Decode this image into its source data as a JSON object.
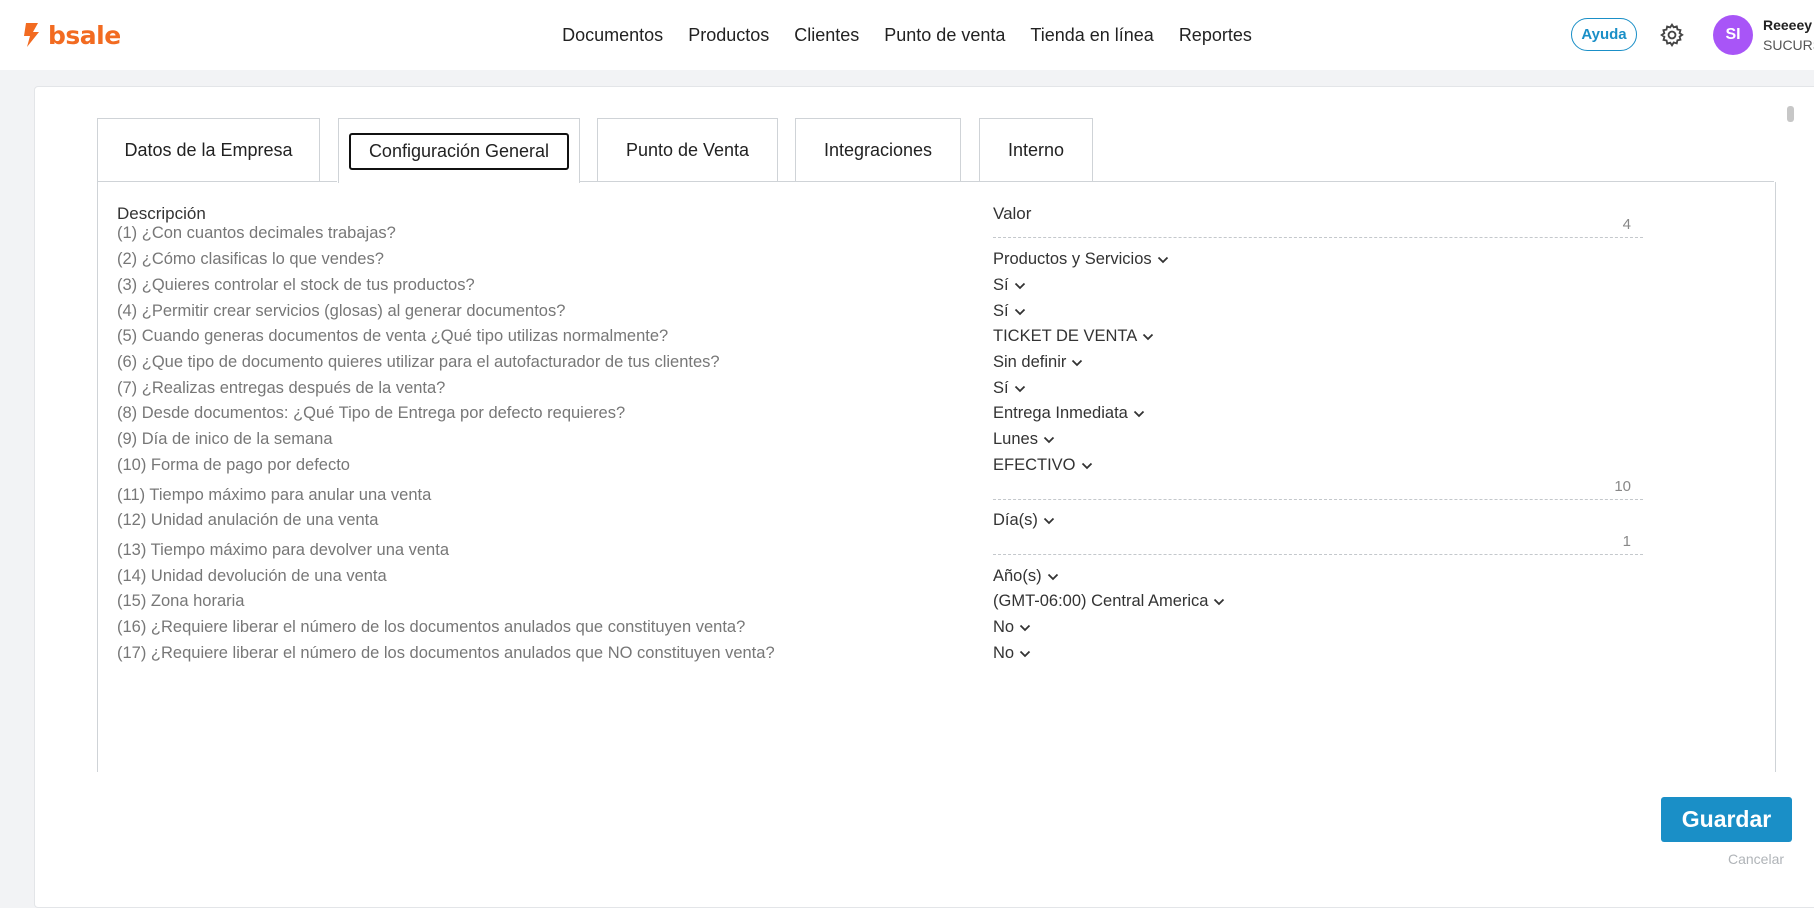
{
  "brand": {
    "logo_text": "bsale",
    "logo_color": "#f26b21"
  },
  "nav": {
    "items": [
      "Documentos",
      "Productos",
      "Clientes",
      "Punto de venta",
      "Tienda en línea",
      "Reportes"
    ]
  },
  "header": {
    "help_label": "Ayuda",
    "avatar_initials": "SI",
    "user_name": "Reeeey",
    "user_branch": "SUCURS"
  },
  "tabs": [
    {
      "label": "Datos de la Empresa",
      "active": false
    },
    {
      "label": "Configuración General",
      "active": true
    },
    {
      "label": "Punto de Venta",
      "active": false
    },
    {
      "label": "Integraciones",
      "active": false
    },
    {
      "label": "Interno",
      "active": false
    }
  ],
  "table": {
    "col_description": "Descripción",
    "col_value": "Valor",
    "rows": [
      {
        "desc": "(1) ¿Con cuantos decimales trabajas?",
        "kind": "number",
        "value": "4"
      },
      {
        "desc": "(2) ¿Cómo clasificas lo que vendes?",
        "kind": "select",
        "value": "Productos y Servicios"
      },
      {
        "desc": "(3) ¿Quieres controlar el stock de tus productos?",
        "kind": "select",
        "value": "Sí"
      },
      {
        "desc": "(4) ¿Permitir crear servicios (glosas) al generar documentos?",
        "kind": "select",
        "value": "Sí"
      },
      {
        "desc": "(5) Cuando generas documentos de venta ¿Qué tipo utilizas normalmente?",
        "kind": "select",
        "value": "TICKET DE VENTA"
      },
      {
        "desc": "(6) ¿Que tipo de documento quieres utilizar para el autofacturador de tus clientes?",
        "kind": "select",
        "value": "Sin definir"
      },
      {
        "desc": "(7) ¿Realizas entregas después de la venta?",
        "kind": "select",
        "value": "Sí"
      },
      {
        "desc": "(8) Desde documentos: ¿Qué Tipo de Entrega por defecto requieres?",
        "kind": "select",
        "value": "Entrega Inmediata"
      },
      {
        "desc": "(9) Día de inico de la semana",
        "kind": "select",
        "value": "Lunes"
      },
      {
        "desc": "(10) Forma de pago por defecto",
        "kind": "select",
        "value": "EFECTIVO"
      },
      {
        "desc": "(11) Tiempo máximo para anular una venta",
        "kind": "number",
        "value": "10"
      },
      {
        "desc": "(12) Unidad anulación de una venta",
        "kind": "select",
        "value": "Día(s)"
      },
      {
        "desc": "(13) Tiempo máximo para devolver una venta",
        "kind": "number",
        "value": "1"
      },
      {
        "desc": "(14) Unidad devolución de una venta",
        "kind": "select",
        "value": "Año(s)"
      },
      {
        "desc": "(15) Zona horaria",
        "kind": "select",
        "value": "(GMT-06:00) Central America"
      },
      {
        "desc": "(16) ¿Requiere liberar el número de los documentos anulados que constituyen venta?",
        "kind": "select",
        "value": "No"
      },
      {
        "desc": "(17) ¿Requiere liberar el número de los documentos anulados que NO constituyen venta?",
        "kind": "select",
        "value": "No"
      }
    ]
  },
  "actions": {
    "save_label": "Guardar",
    "cancel_label": "Cancelar"
  },
  "colors": {
    "primary": "#1a8fc7",
    "avatar": "#a855f7"
  },
  "icons": {
    "settings": "gear-icon",
    "dropdown": "chevron-down-icon",
    "logo": "bsale-logo-icon"
  }
}
